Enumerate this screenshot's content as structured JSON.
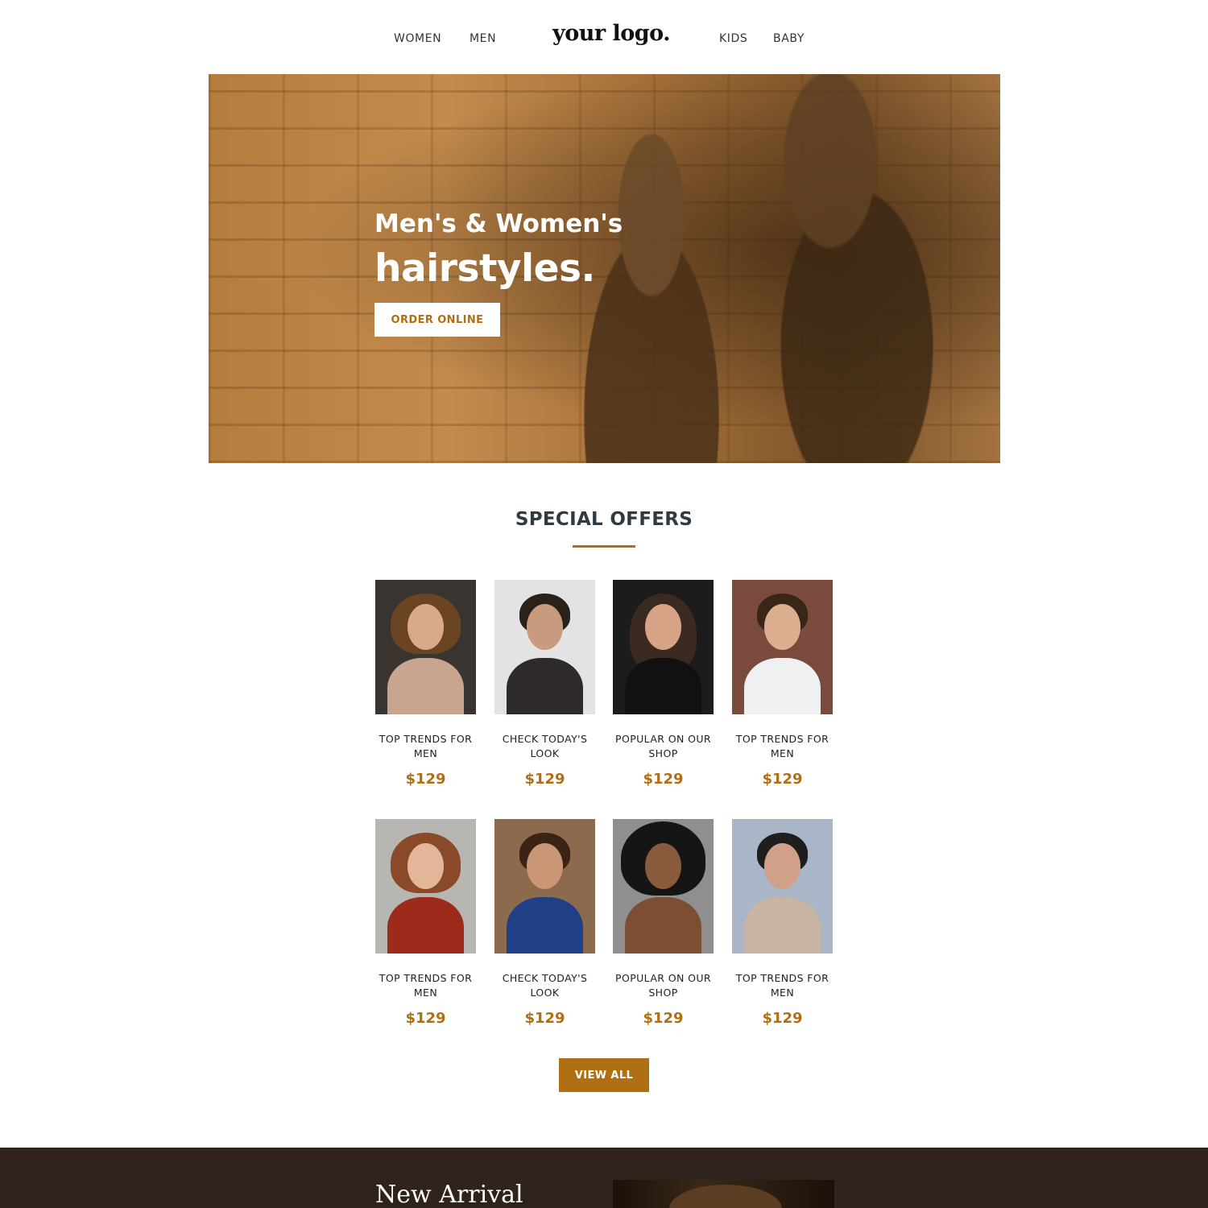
{
  "nav": {
    "links_left": [
      "WOMEN",
      "MEN"
    ],
    "logo": "your logo.",
    "links_right": [
      "KIDS",
      "BABY"
    ]
  },
  "hero": {
    "line1": "Men's & Women's",
    "line2": "hairstyles.",
    "button": "ORDER ONLINE"
  },
  "offers": {
    "title": "SPECIAL OFFERS",
    "items": [
      {
        "label": "TOP TRENDS FOR MEN",
        "price": "$129"
      },
      {
        "label": "CHECK TODAY'S LOOK",
        "price": "$129"
      },
      {
        "label": "POPULAR ON OUR SHOP",
        "price": "$129"
      },
      {
        "label": "TOP TRENDS FOR MEN",
        "price": "$129"
      },
      {
        "label": "TOP TRENDS FOR MEN",
        "price": "$129"
      },
      {
        "label": "CHECK TODAY'S LOOK",
        "price": "$129"
      },
      {
        "label": "POPULAR ON OUR SHOP",
        "price": "$129"
      },
      {
        "label": "TOP TRENDS FOR MEN",
        "price": "$129"
      }
    ],
    "view_all": "VIEW ALL"
  },
  "new_arrival": {
    "title": "New Arrival"
  },
  "colors": {
    "accent": "#b06f12",
    "heading": "#2f3b43",
    "dark_section": "#30221c"
  }
}
